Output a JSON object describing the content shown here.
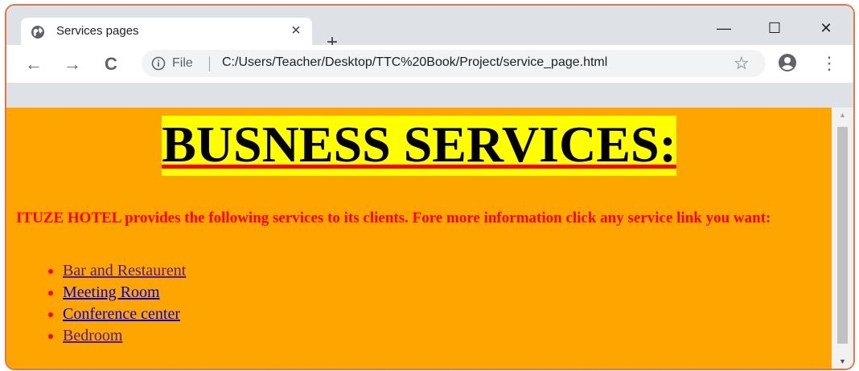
{
  "browser": {
    "tab_title": "Services pages",
    "tab_close": "×",
    "new_tab": "+",
    "window_controls": {
      "minimize": "—",
      "maximize": "☐",
      "close": "✕"
    },
    "nav": {
      "back": "←",
      "forward": "→",
      "reload": "C"
    },
    "address_bar": {
      "scheme_label": "File",
      "url": "C:/Users/Teacher/Desktop/TTC%20Book/Project/service_page.html"
    },
    "bookmark": "☆",
    "menu": "⋮"
  },
  "page": {
    "background": "#ffa500",
    "heading": "BUSNESS SERVICES:",
    "heading_bg": "#ffff00",
    "intro": "ITUZE HOTEL provides the following services to its clients. Fore more information click any service link you want:",
    "services": [
      {
        "label": "Bar and Restaurent",
        "visited": true
      },
      {
        "label": "Meeting Room",
        "visited": false
      },
      {
        "label": "Conference center",
        "visited": false
      },
      {
        "label": "Bedroom",
        "visited": true
      }
    ]
  },
  "scrollbar": {
    "up": "▲",
    "down": "▼"
  }
}
